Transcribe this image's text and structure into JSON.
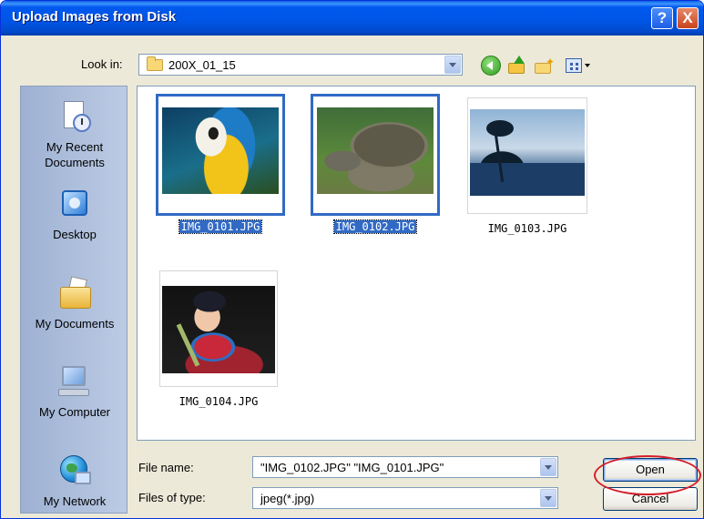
{
  "window": {
    "title": "Upload Images from Disk",
    "help_glyph": "?",
    "close_glyph": "X"
  },
  "lookin": {
    "label": "Look in:",
    "value": "200X_01_15"
  },
  "toolbar": {
    "icons": [
      "back-icon",
      "up-folder-icon",
      "new-folder-icon",
      "views-menu-icon"
    ]
  },
  "places": [
    {
      "label_line1": "My Recent",
      "label_line2": "Documents",
      "icon": "recent-documents-icon"
    },
    {
      "label_line1": "Desktop",
      "label_line2": "",
      "icon": "desktop-icon"
    },
    {
      "label_line1": "My Documents",
      "label_line2": "",
      "icon": "my-documents-icon"
    },
    {
      "label_line1": "My Computer",
      "label_line2": "",
      "icon": "my-computer-icon"
    },
    {
      "label_line1": "My Network",
      "label_line2": "",
      "icon": "my-network-icon"
    }
  ],
  "files": [
    {
      "name": "IMG_0101.JPG",
      "selected": true,
      "subject": "parrot"
    },
    {
      "name": "IMG_0102.JPG",
      "selected": true,
      "subject": "tortoise"
    },
    {
      "name": "IMG_0103.JPG",
      "selected": false,
      "subject": "beach"
    },
    {
      "name": "IMG_0104.JPG",
      "selected": false,
      "subject": "child"
    }
  ],
  "filename": {
    "label": "File name:",
    "value": "\"IMG_0102.JPG\" \"IMG_0101.JPG\""
  },
  "filetype": {
    "label": "Files of type:",
    "value": "jpeg(*.jpg)"
  },
  "buttons": {
    "open": "Open",
    "cancel": "Cancel"
  },
  "colors": {
    "titlebar": "#0055e5",
    "selection": "#316ac5",
    "highlight_ring": "#d41f2c"
  }
}
